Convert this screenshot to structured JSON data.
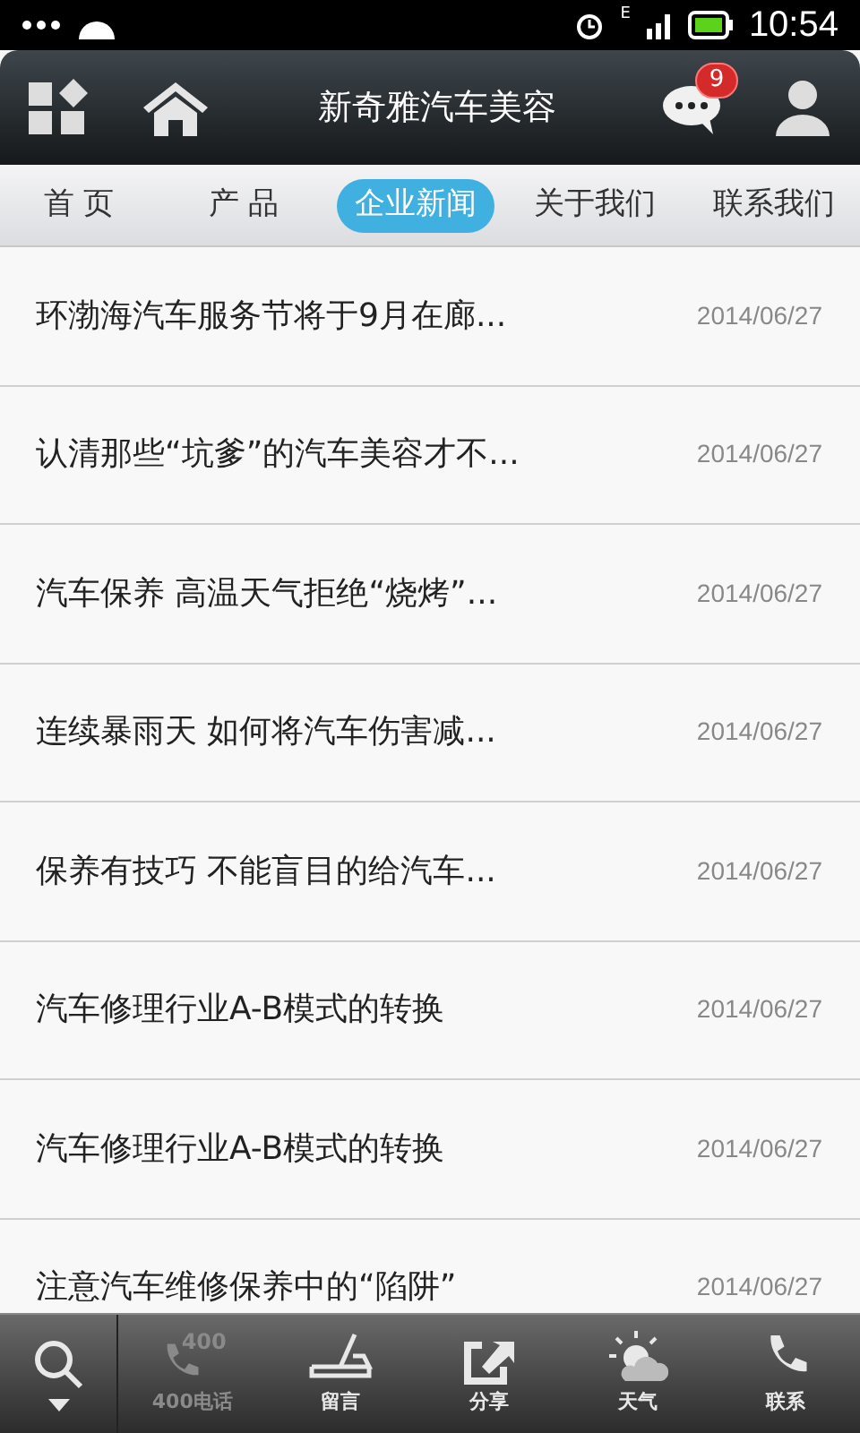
{
  "status_bar": {
    "time": "10:54",
    "network": "E"
  },
  "header": {
    "title": "新奇雅汽车美容",
    "message_count": "9"
  },
  "tabs": [
    {
      "label": "首 页",
      "selected": false
    },
    {
      "label": "产 品",
      "selected": false
    },
    {
      "label": "企业新闻",
      "selected": true
    },
    {
      "label": "关于我们",
      "selected": false
    },
    {
      "label": "联系我们",
      "selected": false
    }
  ],
  "news": [
    {
      "title": "环渤海汽车服务节将于9月在廊...",
      "date": "2014/06/27"
    },
    {
      "title": "认清那些“坑爹”的汽车美容才不...",
      "date": "2014/06/27"
    },
    {
      "title": "汽车保养 高温天气拒绝“烧烤”...",
      "date": "2014/06/27"
    },
    {
      "title": "连续暴雨天 如何将汽车伤害减...",
      "date": "2014/06/27"
    },
    {
      "title": "保养有技巧 不能盲目的给汽车...",
      "date": "2014/06/27"
    },
    {
      "title": "汽车修理行业A-B模式的转换",
      "date": "2014/06/27"
    },
    {
      "title": "汽车修理行业A-B模式的转换",
      "date": "2014/06/27"
    },
    {
      "title": "注意汽车维修保养中的“陷阱”",
      "date": "2014/06/27"
    }
  ],
  "toolbar": [
    {
      "kind": "phone400",
      "label": "400电话",
      "icon_text": "400",
      "disabled": true
    },
    {
      "kind": "message",
      "label": "留言",
      "disabled": false
    },
    {
      "kind": "share",
      "label": "分享",
      "disabled": false
    },
    {
      "kind": "weather",
      "label": "天气",
      "disabled": false
    },
    {
      "kind": "contact",
      "label": "联系",
      "disabled": false
    }
  ]
}
